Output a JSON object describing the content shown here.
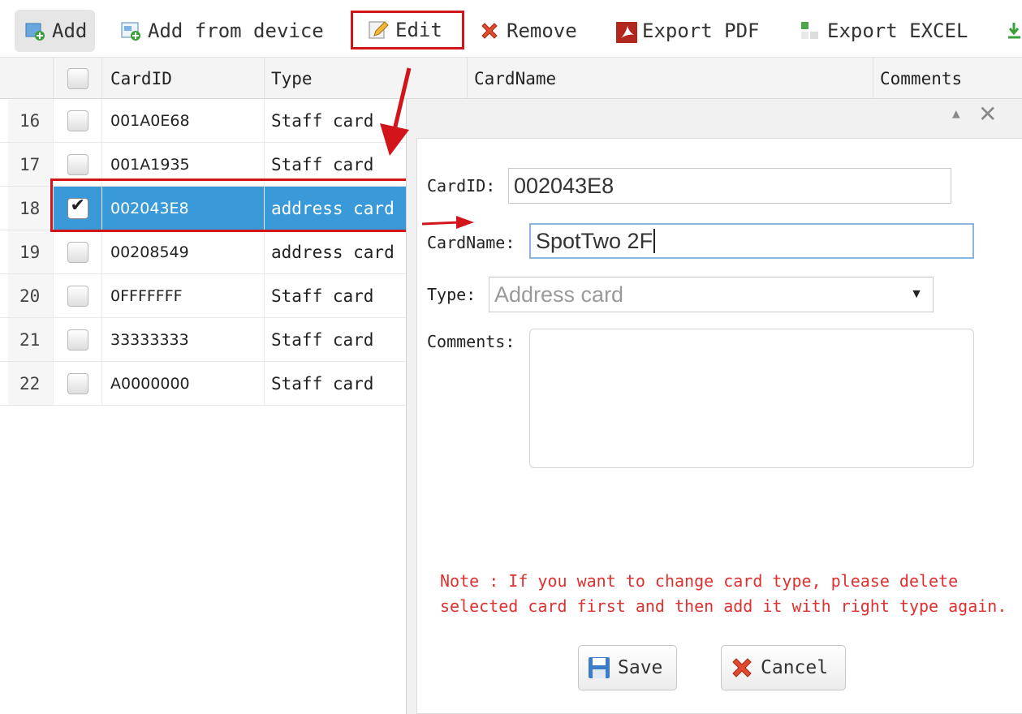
{
  "toolbar": {
    "add": "Add",
    "add_from_device": "Add from device",
    "edit": "Edit",
    "remove": "Remove",
    "export_pdf": "Export PDF",
    "export_excel": "Export EXCEL"
  },
  "grid": {
    "headers": {
      "card_id": "CardID",
      "type": "Type",
      "card_name": "CardName",
      "comments": "Comments"
    },
    "rows": [
      {
        "num": "16",
        "card_id": "001A0E68",
        "type": "Staff card",
        "checked": false
      },
      {
        "num": "17",
        "card_id": "001A1935",
        "type": "Staff card",
        "checked": false
      },
      {
        "num": "18",
        "card_id": "002043E8",
        "type": "address card",
        "checked": true
      },
      {
        "num": "19",
        "card_id": "00208549",
        "type": "address card",
        "checked": false
      },
      {
        "num": "20",
        "card_id": "0FFFFFFF",
        "type": "Staff card",
        "checked": false
      },
      {
        "num": "21",
        "card_id": "33333333",
        "type": "Staff card",
        "checked": false
      },
      {
        "num": "22",
        "card_id": "A0000000",
        "type": "Staff card",
        "checked": false
      }
    ]
  },
  "dialog": {
    "card_id_label": "CardID:",
    "card_id_value": "002043E8",
    "card_name_label": "CardName:",
    "card_name_value": "SpotTwo 2F",
    "type_label": "Type:",
    "type_value": "Address card",
    "comments_label": "Comments:",
    "note": "Note : If you want to change card type, please delete selected card first and then add it with right type again.",
    "save": "Save",
    "cancel": "Cancel"
  },
  "colors": {
    "highlight_red": "#d2151b",
    "selection_blue": "#3a9ad9",
    "note_red": "#e03030"
  }
}
